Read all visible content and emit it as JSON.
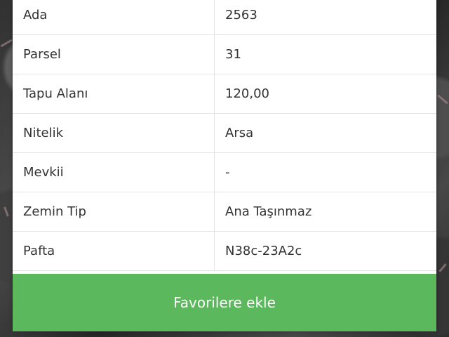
{
  "property": {
    "rows": [
      {
        "label": "Ada",
        "value": "2563"
      },
      {
        "label": "Parsel",
        "value": "31"
      },
      {
        "label": "Tapu Alanı",
        "value": "120,00"
      },
      {
        "label": "Nitelik",
        "value": "Arsa"
      },
      {
        "label": "Mevkii",
        "value": "-"
      },
      {
        "label": "Zemin Tip",
        "value": "Ana Taşınmaz"
      },
      {
        "label": "Pafta",
        "value": "N38c-23A2c"
      }
    ]
  },
  "actions": {
    "add_favorite_label": "Favorilere ekle"
  },
  "colors": {
    "button": "#5cb85c",
    "text": "#333333",
    "border": "#e3e3e3"
  }
}
